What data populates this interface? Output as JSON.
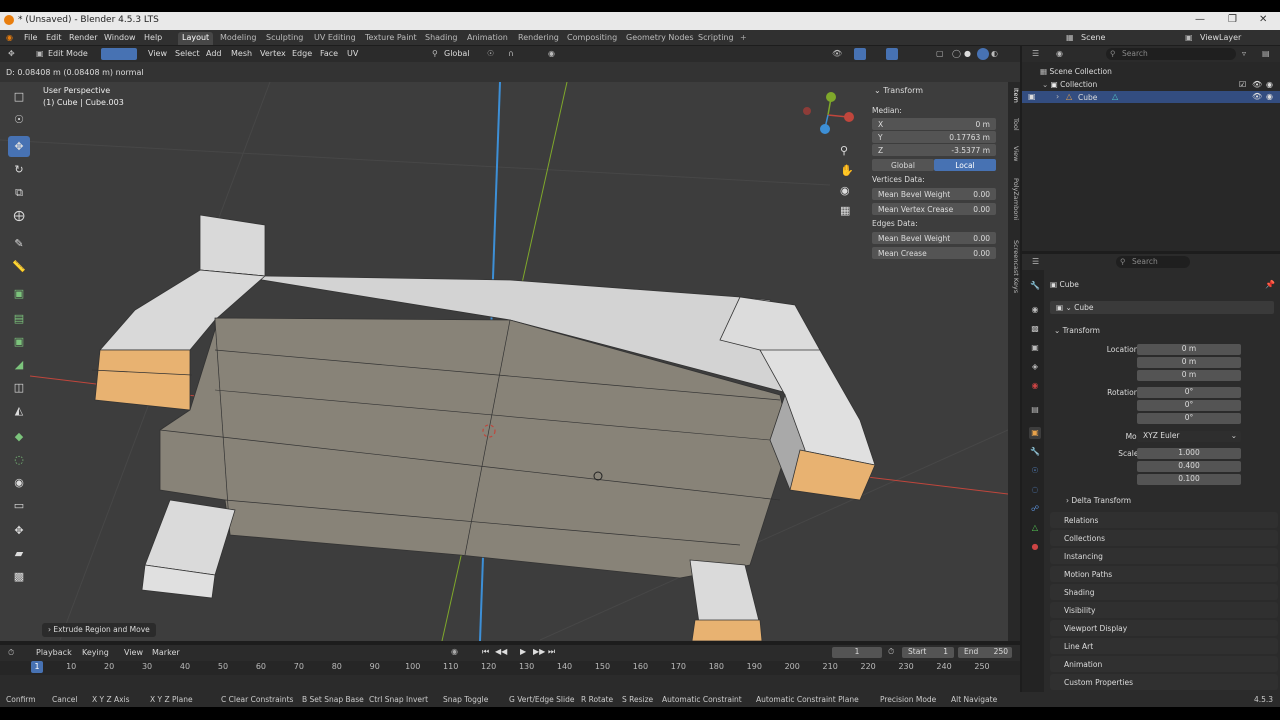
{
  "window": {
    "title": "* (Unsaved) - Blender 4.5.3 LTS"
  },
  "topbar": {
    "menus": [
      "File",
      "Edit",
      "Render",
      "Window",
      "Help"
    ],
    "workspaces": [
      "Layout",
      "Modeling",
      "Sculpting",
      "UV Editing",
      "Texture Paint",
      "Shading",
      "Animation",
      "Rendering",
      "Compositing",
      "Geometry Nodes",
      "Scripting"
    ],
    "active_workspace": "Layout",
    "scene": "Scene",
    "view_layer": "ViewLayer",
    "add_tab": "+"
  },
  "viewport_header": {
    "mode": "Edit Mode",
    "menus": [
      "View",
      "Select",
      "Add",
      "Mesh",
      "Vertex",
      "Edge",
      "Face",
      "UV"
    ],
    "orientation": "Global"
  },
  "operator_status": "D: 0.08408 m (0.08408 m) normal",
  "viewport": {
    "perspective": "User Perspective",
    "object_info": "(1) Cube | Cube.003",
    "last_operator": "Extrude Region and Move",
    "colors": {
      "bg": "#3d3d3d",
      "face_top": "#d6d6d6",
      "face_side": "#8a857c",
      "selected": "#e8b271",
      "x_axis": "#c0463c",
      "y_axis": "#7fa82b",
      "z_axis": "#3d8fd6"
    }
  },
  "transform_panel": {
    "title": "Transform",
    "median_label": "Median:",
    "x_label": "X",
    "x": "0 m",
    "y_label": "Y",
    "y": "0.17763 m",
    "z_label": "Z",
    "z": "-3.5377 m",
    "global": "Global",
    "local": "Local",
    "vertices_label": "Vertices Data:",
    "v_bevel_label": "Mean Bevel Weight",
    "v_bevel": "0.00",
    "v_crease_label": "Mean Vertex Crease",
    "v_crease": "0.00",
    "edges_label": "Edges Data:",
    "e_bevel_label": "Mean Bevel Weight",
    "e_bevel": "0.00",
    "e_crease_label": "Mean Crease",
    "e_crease": "0.00"
  },
  "sidebar_tabs": [
    "Item",
    "Tool",
    "View",
    "PolyZamboni",
    "Screencast Keys"
  ],
  "outliner": {
    "search_placeholder": "Search",
    "scene_collection": "Scene Collection",
    "collection": "Collection",
    "object": "Cube"
  },
  "properties": {
    "search_placeholder": "Search",
    "object_name": "Cube",
    "data_name": "Cube",
    "transform_header": "Transform",
    "location_x_label": "Location X",
    "location_x": "0 m",
    "location_y_label": "Y",
    "location_y": "0 m",
    "location_z_label": "Z",
    "location_z": "0 m",
    "rotation_x_label": "Rotation X",
    "rotation_x": "0°",
    "rotation_y_label": "Y",
    "rotation_y": "0°",
    "rotation_z_label": "Z",
    "rotation_z": "0°",
    "mode_label": "Mode",
    "mode": "XYZ Euler",
    "scale_x_label": "Scale X",
    "scale_x": "1.000",
    "scale_y_label": "Y",
    "scale_y": "0.400",
    "scale_z_label": "Z",
    "scale_z": "0.100",
    "delta_transform": "Delta Transform",
    "panels": [
      "Relations",
      "Collections",
      "Instancing",
      "Motion Paths",
      "Shading",
      "Visibility",
      "Viewport Display",
      "Line Art",
      "Animation",
      "Custom Properties"
    ]
  },
  "timeline": {
    "menus": [
      "Playback",
      "Keying",
      "View",
      "Marker"
    ],
    "current_frame": "1",
    "start_label": "Start",
    "start": "1",
    "end_label": "End",
    "end": "250",
    "ticks": [
      "1",
      "10",
      "20",
      "30",
      "40",
      "50",
      "60",
      "70",
      "80",
      "90",
      "100",
      "110",
      "120",
      "130",
      "140",
      "150",
      "160",
      "170",
      "180",
      "190",
      "200",
      "210",
      "220",
      "230",
      "240",
      "250"
    ]
  },
  "statusbar": {
    "items": [
      "Confirm",
      "Cancel",
      "X Y Z Axis",
      "X Y Z Plane",
      "C Clear Constraints",
      "B Set Snap Base",
      "Ctrl Snap Invert",
      "Snap Toggle",
      "G Vert/Edge Slide",
      "R Rotate",
      "S Resize",
      "Automatic Constraint",
      "Automatic Constraint Plane",
      "Precision Mode",
      "Alt Navigate"
    ],
    "version": "4.5.3"
  }
}
